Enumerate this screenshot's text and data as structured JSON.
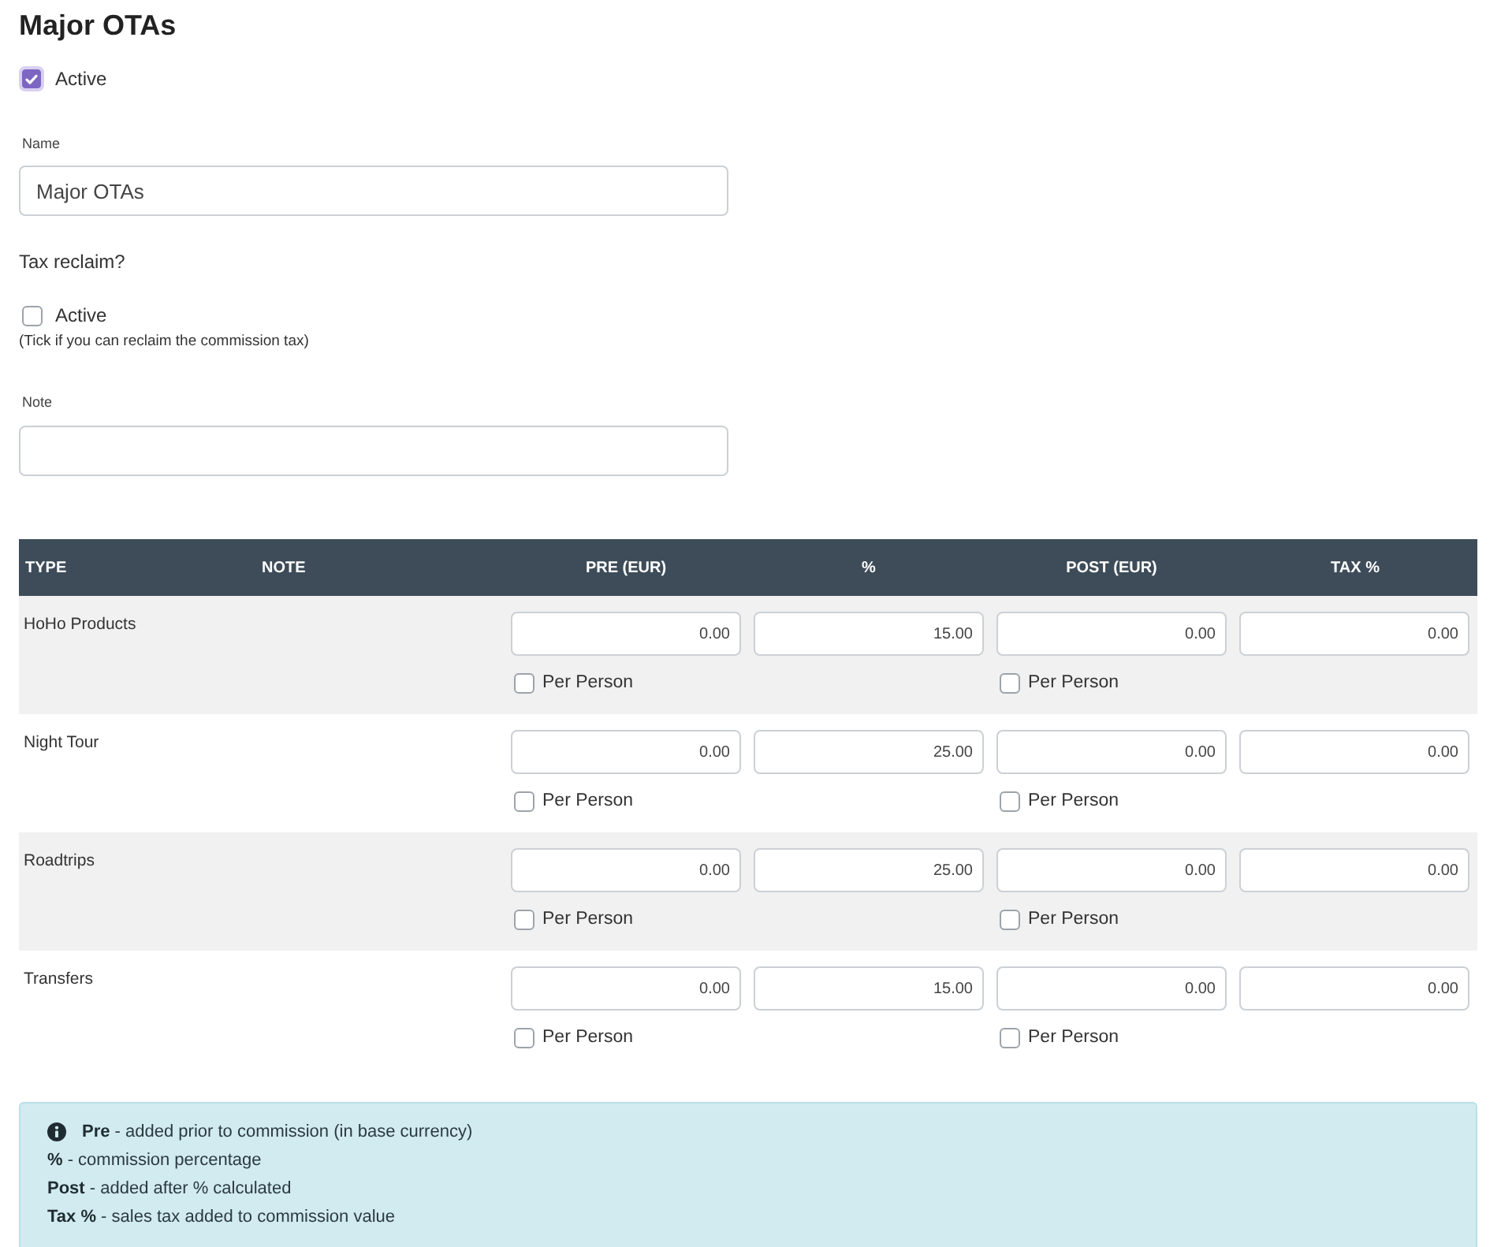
{
  "title": "Major OTAs",
  "active": {
    "label": "Active",
    "checked": true
  },
  "name_field": {
    "label": "Name",
    "value": "Major OTAs"
  },
  "tax_reclaim": {
    "heading": "Tax reclaim?",
    "checkbox": {
      "label": "Active",
      "checked": false
    },
    "hint": "(Tick if you can reclaim the commission tax)"
  },
  "note_field": {
    "label": "Note"
  },
  "table": {
    "columns": [
      "TYPE",
      "NOTE",
      "PRE (EUR)",
      "%",
      "POST (EUR)",
      "TAX %"
    ],
    "rows": [
      {
        "type": "HoHo Products",
        "pre": "0.00",
        "pre_per_person": {
          "label": "Per Person",
          "checked": false
        },
        "percent": "15.00",
        "post": "0.00",
        "post_per_person": {
          "label": "Per Person",
          "checked": false
        },
        "tax": "0.00"
      },
      {
        "type": "Night Tour",
        "pre": "0.00",
        "pre_per_person": {
          "label": "Per Person",
          "checked": false
        },
        "percent": "25.00",
        "post": "0.00",
        "post_per_person": {
          "label": "Per Person",
          "checked": false
        },
        "tax": "0.00"
      },
      {
        "type": "Roadtrips",
        "pre": "0.00",
        "pre_per_person": {
          "label": "Per Person",
          "checked": false
        },
        "percent": "25.00",
        "post": "0.00",
        "post_per_person": {
          "label": "Per Person",
          "checked": false
        },
        "tax": "0.00"
      },
      {
        "type": "Transfers",
        "pre": "0.00",
        "pre_per_person": {
          "label": "Per Person",
          "checked": false
        },
        "percent": "15.00",
        "post": "0.00",
        "post_per_person": {
          "label": "Per Person",
          "checked": false
        },
        "tax": "0.00"
      }
    ]
  },
  "info": {
    "lines": [
      "**Pre** - added prior to commission (in base currency)",
      "**%** - commission percentage",
      "**Post** - added after % calculated",
      "**Tax %** - sales tax added to commission value"
    ]
  }
}
